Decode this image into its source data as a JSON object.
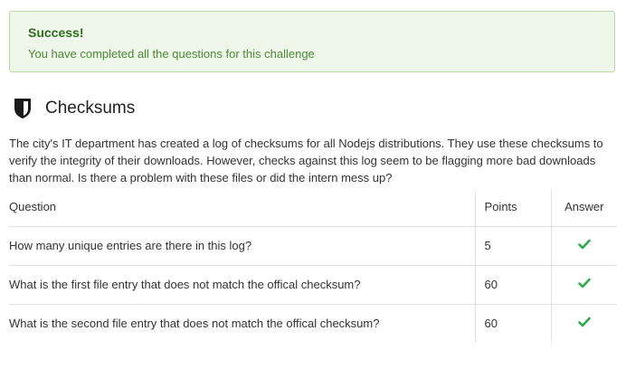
{
  "alert": {
    "title": "Success!",
    "message": "You have completed all the questions for this challenge",
    "status_color": "#2f6d1e"
  },
  "challenge": {
    "icon": "shield-icon",
    "title": "Checksums",
    "description": "The city's IT department has created a log of checksums for all Nodejs distributions. They use these checksums to verify the integrity of their downloads. However, checks against this log seem to be flagging more bad downloads than normal. Is there a problem with these files or did the intern mess up?"
  },
  "table": {
    "headers": {
      "question": "Question",
      "points": "Points",
      "answer": "Answer"
    },
    "rows": [
      {
        "question": "How many unique entries are there in this log?",
        "points": "5",
        "answer_icon": "checkmark-icon"
      },
      {
        "question": "What is the first file entry that does not match the offical checksum?",
        "points": "60",
        "answer_icon": "checkmark-icon"
      },
      {
        "question": "What is the second file entry that does not match the offical checksum?",
        "points": "60",
        "answer_icon": "checkmark-icon"
      }
    ],
    "check_color": "#2fa84f"
  }
}
